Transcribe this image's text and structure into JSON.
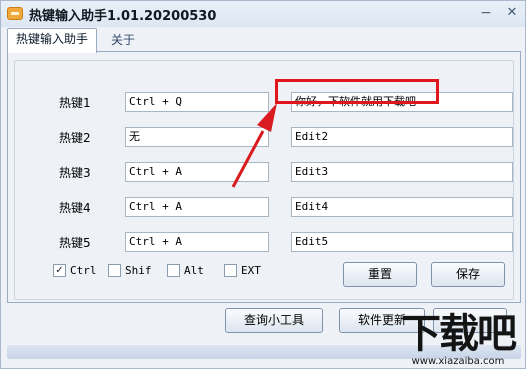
{
  "window": {
    "title": "热键输入助手1.01.20200530",
    "minimize_glyph": "−",
    "close_glyph": "✕"
  },
  "tabs": [
    {
      "label": "热键输入助手",
      "active": true
    },
    {
      "label": "关于",
      "active": false
    }
  ],
  "rows": [
    {
      "label": "热键1",
      "hotkey": "Ctrl + Q",
      "text": "你好，下软件就用下载吧"
    },
    {
      "label": "热键2",
      "hotkey": "无",
      "text": "Edit2"
    },
    {
      "label": "热键3",
      "hotkey": "Ctrl + A",
      "text": "Edit3"
    },
    {
      "label": "热键4",
      "hotkey": "Ctrl + A",
      "text": "Edit4"
    },
    {
      "label": "热键5",
      "hotkey": "Ctrl + A",
      "text": "Edit5"
    }
  ],
  "modifiers": [
    {
      "label": "Ctrl",
      "checked": true
    },
    {
      "label": "Shif",
      "checked": false
    },
    {
      "label": "Alt",
      "checked": false
    },
    {
      "label": "EXT",
      "checked": false
    }
  ],
  "buttons": {
    "reset": "重置",
    "save": "保存",
    "query": "查询小工具",
    "update": "软件更新"
  },
  "annotation": {
    "highlight_color": "#e0161b",
    "arrow_color": "#d91a1f"
  },
  "watermark": {
    "big": "下载吧",
    "small": "www.xiazaiba.com"
  },
  "colors": {
    "window_bg": "#eef2f7",
    "accent_icon": "#f2a93b"
  }
}
